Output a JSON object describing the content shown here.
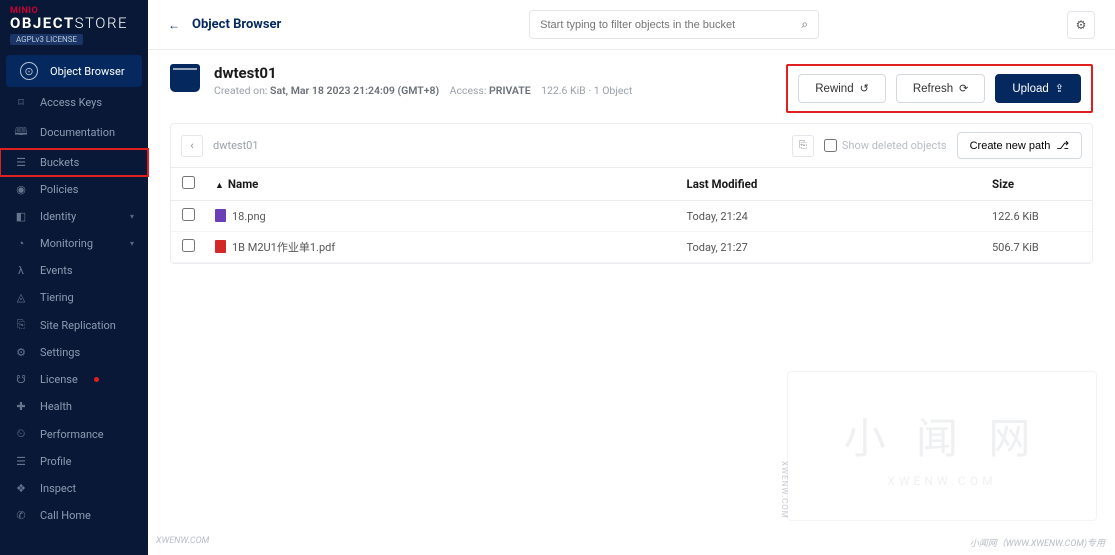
{
  "logo": {
    "brand": "MINIO",
    "product_bold": "OBJECT",
    "product_light": "STORE",
    "license_badge": "AGPLv3  LICENSE"
  },
  "sidebar": {
    "items": [
      {
        "label": "Object Browser",
        "icon": "⊙",
        "active": true
      },
      {
        "label": "Access Keys",
        "icon": "⌑"
      },
      {
        "label": "Documentation",
        "icon": "🕮"
      },
      {
        "label": "Buckets",
        "icon": "☰",
        "highlighted": true
      },
      {
        "label": "Policies",
        "icon": "◉"
      },
      {
        "label": "Identity",
        "icon": "◧",
        "expand": true
      },
      {
        "label": "Monitoring",
        "icon": "◔",
        "expand": true
      },
      {
        "label": "Events",
        "icon": "λ"
      },
      {
        "label": "Tiering",
        "icon": "◬"
      },
      {
        "label": "Site Replication",
        "icon": "⎘"
      },
      {
        "label": "Settings",
        "icon": "⚙"
      },
      {
        "label": "License",
        "icon": "☋",
        "dot": true
      },
      {
        "label": "Health",
        "icon": "✚"
      },
      {
        "label": "Performance",
        "icon": "⏲"
      },
      {
        "label": "Profile",
        "icon": "☰"
      },
      {
        "label": "Inspect",
        "icon": "❖"
      },
      {
        "label": "Call Home",
        "icon": "✆"
      }
    ]
  },
  "topbar": {
    "title": "Object Browser",
    "search_placeholder": "Start typing to filter objects in the bucket"
  },
  "bucket": {
    "name": "dwtest01",
    "created_label": "Created on:",
    "created_value": "Sat, Mar 18 2023 21:24:09 (GMT+8)",
    "access_label": "Access:",
    "access_value": "PRIVATE",
    "size": "122.6 KiB",
    "object_count": "1 Object"
  },
  "actions": {
    "rewind": "Rewind",
    "refresh": "Refresh",
    "upload": "Upload"
  },
  "toolbar": {
    "breadcrumb": "dwtest01",
    "show_deleted": "Show deleted objects",
    "create_path": "Create new path"
  },
  "table": {
    "headers": {
      "name": "Name",
      "modified": "Last Modified",
      "size": "Size"
    },
    "rows": [
      {
        "name": "18.png",
        "modified": "Today, 21:24",
        "size": "122.6 KiB",
        "icon": "ico-img"
      },
      {
        "name": "1B M2U1作业单1.pdf",
        "modified": "Today, 21:27",
        "size": "506.7 KiB",
        "icon": "ico-pdf"
      }
    ]
  },
  "watermark": {
    "left": "XWENW.COM",
    "right": "小闻网（WWW.XWENW.COM)专用",
    "box_main": "小 闻 网",
    "box_sub": "XWENW.COM",
    "side": "XWENW.COM"
  }
}
